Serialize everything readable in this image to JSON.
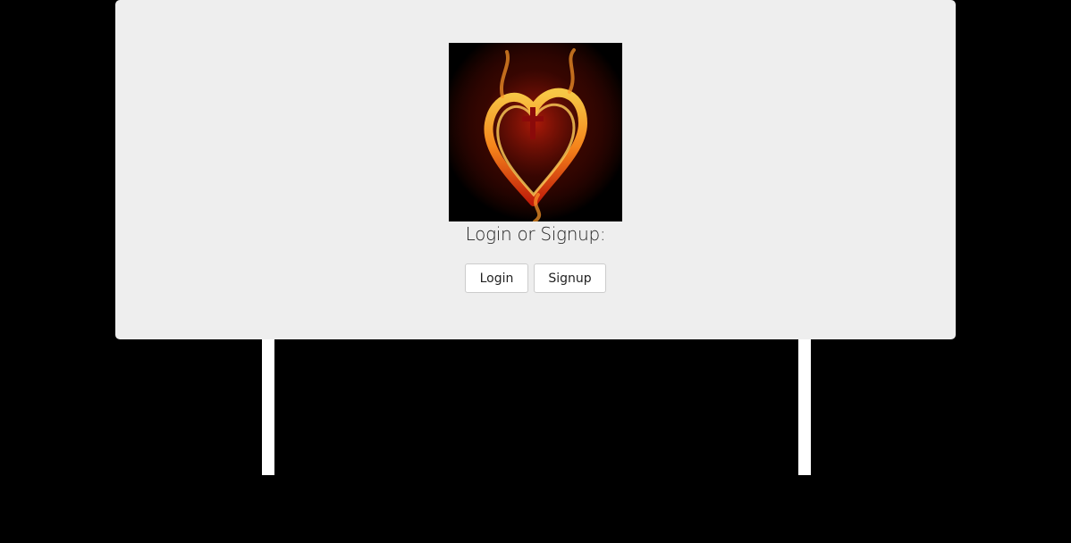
{
  "panel": {
    "prompt": "Login or Signup:",
    "logo_icon": "flaming-heart-cross-icon",
    "buttons": {
      "login_label": "Login",
      "signup_label": "Signup"
    }
  },
  "colors": {
    "page_background": "#000000",
    "panel_background": "#eeeeee",
    "button_background": "#ffffff",
    "button_border": "#cccccc",
    "text": "#222222",
    "flame_orange": "#ff8a1c",
    "flame_red": "#c81e0a",
    "cross": "#8b0a0a"
  }
}
